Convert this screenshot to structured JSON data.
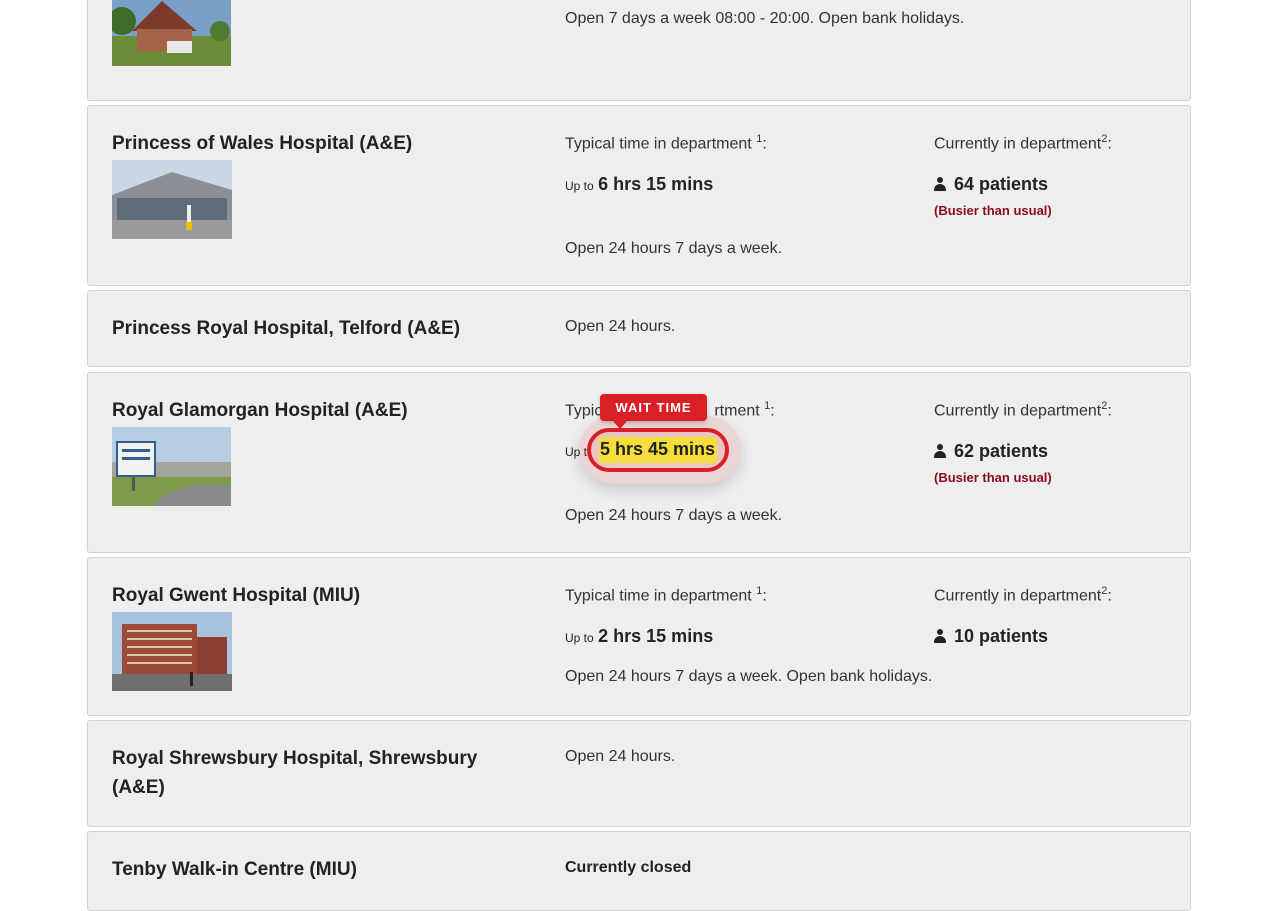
{
  "labels": {
    "typical_time": "Typical time in department",
    "typical_time_sup": "1",
    "typical_time_tail": ":",
    "currently": "Currently in department",
    "currently_sup": "2",
    "currently_tail": ":",
    "up_to": "Up to"
  },
  "hospitals": [
    {
      "hours": "Open 7 days a week 08:00 - 20:00. Open bank holidays."
    },
    {
      "name": "Princess of Wales Hospital (A&E)",
      "wait": "6 hrs 15 mins",
      "patients": "64 patients",
      "status": "(Busier than usual)",
      "hours": "Open 24 hours 7 days a week."
    },
    {
      "name": "Princess Royal Hospital, Telford (A&E)",
      "hours": "Open 24 hours."
    },
    {
      "name": "Royal Glamorgan Hospital (A&E)",
      "label_visible_prefix": "Typic",
      "label_visible_suffix": "rtment",
      "up_to_visible": "Up t",
      "wait": "5 hrs 45 mins",
      "patients": "62 patients",
      "status": "(Busier than usual)",
      "hours": "Open 24 hours 7 days a week."
    },
    {
      "name": "Royal Gwent Hospital (MIU)",
      "wait": "2 hrs 15 mins",
      "patients": "10 patients",
      "hours": "Open 24 hours 7 days a week. Open bank holidays."
    },
    {
      "name": "Royal Shrewsbury Hospital, Shrewsbury (A&E)",
      "hours": "Open 24 hours."
    },
    {
      "name": "Tenby Walk-in Centre (MIU)",
      "hours": "Currently closed"
    }
  ],
  "annotation": {
    "tag": "WAIT TIME",
    "accent_color": "#d92026",
    "highlight_color": "#f4de3b"
  },
  "colors": {
    "card_bg": "#eeeeee",
    "busier_text": "#8b0a1a"
  },
  "icons": {
    "patients": "person-icon"
  }
}
